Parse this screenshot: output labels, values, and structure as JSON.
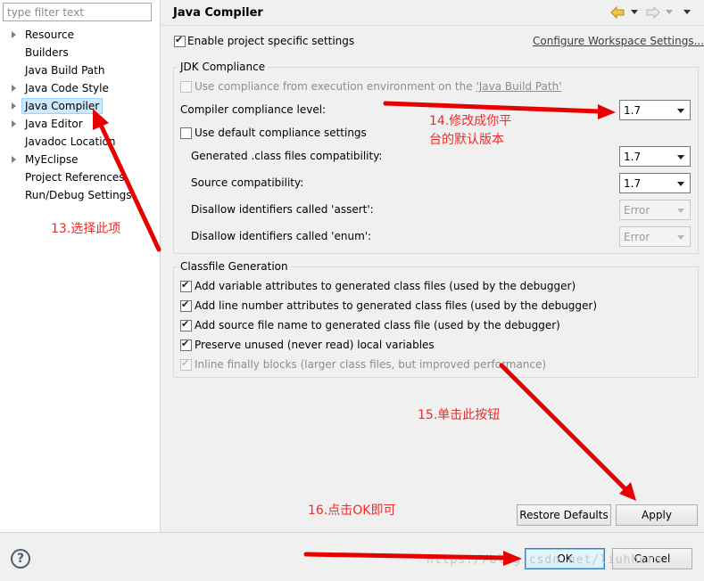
{
  "filter": {
    "placeholder": "type filter text",
    "value": ""
  },
  "tree": {
    "items": [
      {
        "label": "Resource",
        "expandable": true
      },
      {
        "label": "Builders",
        "expandable": false
      },
      {
        "label": "Java Build Path",
        "expandable": false
      },
      {
        "label": "Java Code Style",
        "expandable": true
      },
      {
        "label": "Java Compiler",
        "expandable": true,
        "selected": true
      },
      {
        "label": "Java Editor",
        "expandable": true
      },
      {
        "label": "Javadoc Location",
        "expandable": false
      },
      {
        "label": "MyEclipse",
        "expandable": true
      },
      {
        "label": "Project References",
        "expandable": false
      },
      {
        "label": "Run/Debug Settings",
        "expandable": false
      }
    ]
  },
  "header": {
    "title": "Java Compiler",
    "back_icon": "back-arrow-icon",
    "forward_icon": "forward-arrow-icon",
    "menu_icon": "chevron-down-icon"
  },
  "settings": {
    "enable_specific_label": "Enable project specific settings",
    "enable_specific_checked": true,
    "configure_workspace_link": "Configure Workspace Settings..."
  },
  "jdk": {
    "group_title": "JDK Compliance",
    "use_env_prefix": "Use compliance from execution environment on the ",
    "use_env_link": "'Java Build Path'",
    "use_env_checked": false,
    "compliance_label": "Compiler compliance level:",
    "compliance_value": "1.7",
    "use_default_label": "Use default compliance settings",
    "use_default_checked": false,
    "class_compat_label": "Generated .class files compatibility:",
    "class_compat_value": "1.7",
    "source_compat_label": "Source compatibility:",
    "source_compat_value": "1.7",
    "assert_label": "Disallow identifiers called 'assert':",
    "assert_value": "Error",
    "enum_label": "Disallow identifiers called 'enum':",
    "enum_value": "Error"
  },
  "classfile": {
    "group_title": "Classfile Generation",
    "options": [
      {
        "label": "Add variable attributes to generated class files (used by the debugger)",
        "checked": true,
        "enabled": true
      },
      {
        "label": "Add line number attributes to generated class files (used by the debugger)",
        "checked": true,
        "enabled": true
      },
      {
        "label": "Add source file name to generated class file (used by the debugger)",
        "checked": true,
        "enabled": true
      },
      {
        "label": "Preserve unused (never read) local variables",
        "checked": true,
        "enabled": true
      },
      {
        "label": "Inline finally blocks (larger class files, but improved performance)",
        "checked": true,
        "enabled": false
      }
    ]
  },
  "buttons": {
    "restore_defaults": "Restore Defaults",
    "apply": "Apply",
    "ok": "OK",
    "cancel": "Cancel",
    "help": "?"
  },
  "annotations": {
    "step13": "13.选择此项",
    "step14_line1": "14.修改成你平",
    "step14_line2": "台的默认版本",
    "step15": "15.单击此按钮",
    "step16": "16.点击OK即可",
    "arrow_color": "#e60000"
  },
  "watermark": "https://blog.csdn.net/liuhhers"
}
